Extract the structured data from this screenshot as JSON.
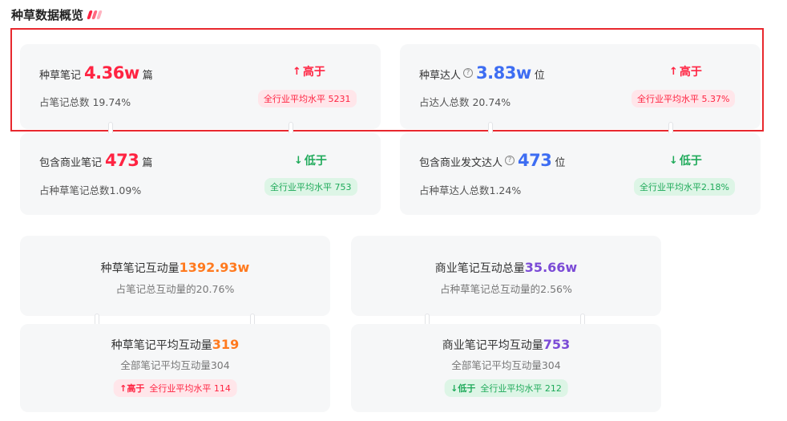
{
  "page": {
    "title": "种草数据概览"
  },
  "colors": {
    "red": "#ff2442",
    "blue": "#3d6df2",
    "green": "#1faa5a",
    "orange": "#ff7a1f",
    "purple": "#7b4bd6"
  },
  "cards": {
    "notes": {
      "label": "种草笔记",
      "value": "4.36w",
      "unit": "篇",
      "sub": "占笔记总数 19.74%",
      "compare": {
        "arrow": "↑",
        "text": "高于"
      },
      "benchmark": "全行业平均水平 5231"
    },
    "creators": {
      "label": "种草达人",
      "help_icon": "?",
      "value": "3.83w",
      "unit": "位",
      "sub": "占达人总数 20.74%",
      "compare": {
        "arrow": "↑",
        "text": "高于"
      },
      "benchmark": "全行业平均水平 5.37%"
    },
    "commercial_notes": {
      "label": "包含商业笔记",
      "value": "473",
      "unit": "篇",
      "sub": "占种草笔记总数1.09%",
      "compare": {
        "arrow": "↓",
        "text": "低于"
      },
      "benchmark": "全行业平均水平 753"
    },
    "commercial_creators": {
      "label": "包含商业发文达人",
      "help_icon": "?",
      "value": "473",
      "unit": "位",
      "sub": "占种草达人总数1.24%",
      "compare": {
        "arrow": "↓",
        "text": "低于"
      },
      "benchmark": "全行业平均水平2.18%"
    }
  },
  "interactions": {
    "notes_total": {
      "label": "种草笔记互动量",
      "value": "1392.93w",
      "sub": "占笔记总互动量的20.76%"
    },
    "commercial_total": {
      "label": "商业笔记互动总量",
      "value": "35.66w",
      "sub": "占种草笔记总互动量的2.56%"
    },
    "notes_avg": {
      "label": "种草笔记平均互动量",
      "value": "319",
      "sub": "全部笔记平均互动量304",
      "compare": {
        "arrow": "↑",
        "text": "高于",
        "benchmark": "全行业平均水平 114"
      }
    },
    "commercial_avg": {
      "label": "商业笔记平均互动量",
      "value": "753",
      "sub": "全部笔记平均互动量304",
      "compare": {
        "arrow": "↓",
        "text": "低于",
        "benchmark": "全行业平均水平 212"
      }
    }
  }
}
